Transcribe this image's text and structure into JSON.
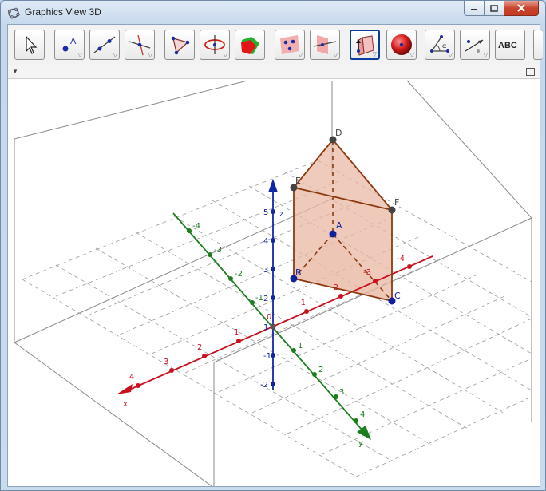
{
  "window": {
    "title": "Graphics View 3D"
  },
  "toolbar": {
    "tools": [
      {
        "name": "move-tool",
        "label": ""
      },
      {
        "name": "point-tool",
        "label": "A"
      },
      {
        "name": "line-tool",
        "label": ""
      },
      {
        "name": "perpendicular-line-tool",
        "label": ""
      },
      {
        "name": "polygon-tool",
        "label": ""
      },
      {
        "name": "circle-axis-tool",
        "label": ""
      },
      {
        "name": "intersect-surfaces-tool",
        "label": ""
      },
      {
        "name": "plane-three-points-tool",
        "label": ""
      },
      {
        "name": "perpendicular-plane-tool",
        "label": ""
      },
      {
        "name": "prism-tool",
        "label": ""
      },
      {
        "name": "sphere-tool",
        "label": ""
      },
      {
        "name": "angle-tool",
        "label": "α"
      },
      {
        "name": "reflect-tool",
        "label": ""
      },
      {
        "name": "text-tool",
        "label": "ABC"
      }
    ]
  },
  "axes": {
    "x_name": "x",
    "y_name": "y",
    "z_name": "z",
    "origin": "0",
    "x_ticks": [
      "-4",
      "-3",
      "-2",
      "-1",
      "1",
      "2",
      "3",
      "4"
    ],
    "y_ticks": [
      "-4",
      "-3",
      "-2",
      "-1",
      "1",
      "2",
      "3",
      "4"
    ],
    "z_ticks": [
      "-2",
      "-1",
      "1",
      "2",
      "3",
      "4",
      "5"
    ]
  },
  "points": [
    "A",
    "B",
    "C",
    "D",
    "E",
    "F"
  ],
  "colors": {
    "x_axis": "#c8101e",
    "y_axis": "#1b7d1e",
    "z_axis": "#1226a8",
    "prism_edge": "#8b3a10",
    "prism_fill": "#e9b8a4",
    "point": "#1020a0",
    "vertex": "#555555"
  }
}
